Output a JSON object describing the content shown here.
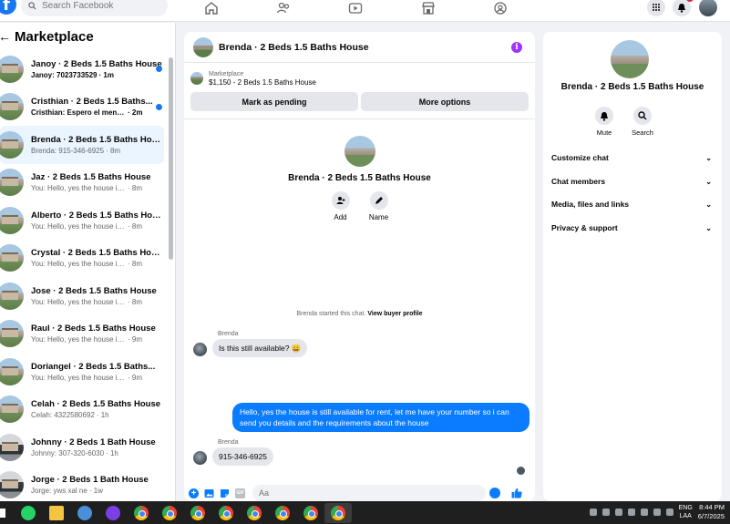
{
  "colors": {
    "accent": "#1877f2",
    "bubble_out": "#0a7cff",
    "bubble_in": "#e4e6eb",
    "active_row": "#ebf5ff",
    "badge": "#e41e3f",
    "info": "#a033ff"
  },
  "topbar": {
    "search_placeholder": "Search Facebook",
    "nav_icons": [
      "home-icon",
      "friends-icon",
      "video-icon",
      "marketplace-icon",
      "groups-icon"
    ],
    "right_icons": [
      "menu-grid-icon",
      "bell-icon",
      "profile-avatar"
    ]
  },
  "sidebar": {
    "title": "Marketplace",
    "conversations": [
      {
        "name": "Janoy · 2 Beds 1.5 Baths House",
        "preview": "Janoy: 7023733529",
        "time": "· 1m",
        "unread": true
      },
      {
        "name": "Cristhian · 2 Beds 1.5 Baths...",
        "preview": "Cristhian: Espero el mensaje...",
        "time": "· 2m",
        "unread": true
      },
      {
        "name": "Brenda · 2 Beds 1.5 Baths House",
        "preview": "Brenda: 915-346-6925",
        "time": "· 8m",
        "active": true
      },
      {
        "name": "Jaz · 2 Beds 1.5 Baths House",
        "preview": "You: Hello, yes the house is still...",
        "time": "· 8m"
      },
      {
        "name": "Alberto · 2 Beds 1.5 Baths House",
        "preview": "You: Hello, yes the house is still...",
        "time": "· 8m"
      },
      {
        "name": "Crystal · 2 Beds 1.5 Baths House",
        "preview": "You: Hello, yes the house is still...",
        "time": "· 8m"
      },
      {
        "name": "Jose · 2 Beds 1.5 Baths House",
        "preview": "You: Hello, yes the house is still...",
        "time": "· 8m"
      },
      {
        "name": "Raul · 2 Beds 1.5 Baths House",
        "preview": "You: Hello, yes the house is still...",
        "time": "· 9m"
      },
      {
        "name": "Doriangel · 2 Beds 1.5 Baths...",
        "preview": "You: Hello, yes the house is still...",
        "time": "· 9m"
      },
      {
        "name": "Celah · 2 Beds 1.5 Baths House",
        "preview": "Celah: 4322580692",
        "time": "· 1h"
      },
      {
        "name": "Johnny · 2 Beds 1 Bath House",
        "preview": "Johnny: 307-320-6030",
        "time": "· 1h"
      },
      {
        "name": "Jorge · 2 Beds 1 Bath House",
        "preview": "Jorge: yws xal ne",
        "time": "· 1w"
      }
    ]
  },
  "chat": {
    "title": "Brenda · 2 Beds 1.5 Baths House",
    "listing_source": "Marketplace",
    "listing_price": "$1,150 - 2 Beds 1.5 Baths House",
    "mark_pending": "Mark as pending",
    "more_options": "More options",
    "profile_name": "Brenda · 2 Beds 1.5 Baths House",
    "add_label": "Add",
    "name_label": "Name",
    "started_text": "Brenda started this chat.",
    "view_profile": "View buyer profile",
    "sender1": "Brenda",
    "msg1": "Is this still available?",
    "msg1_emoji": "😄",
    "reply": "Hello, yes the house is still available for rent, let me have your number so i can send you details and the requirements about the house",
    "sender2": "Brenda",
    "msg2": "915-346-6925",
    "composer_placeholder": "Aa"
  },
  "rpanel": {
    "name": "Brenda · 2 Beds 1.5 Baths House",
    "mute": "Mute",
    "search": "Search",
    "sections": [
      "Customize chat",
      "Chat members",
      "Media, files and links",
      "Privacy & support"
    ]
  },
  "taskbar": {
    "lang_line1": "ENG",
    "lang_line2": "LAA",
    "time": "8:44 PM",
    "date": "6/7/2025"
  }
}
